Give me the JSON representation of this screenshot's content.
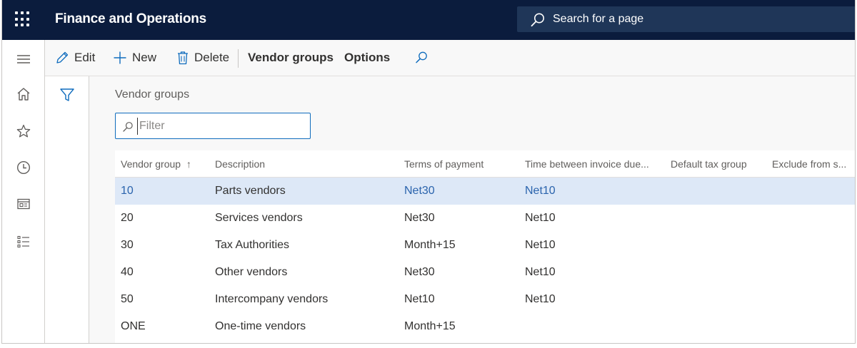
{
  "app": {
    "title": "Finance and Operations"
  },
  "search": {
    "placeholder": "Search for a page"
  },
  "nav": {
    "items": [
      {
        "name": "hamburger-icon"
      },
      {
        "name": "home-icon"
      },
      {
        "name": "star-icon"
      },
      {
        "name": "clock-icon"
      },
      {
        "name": "workspace-icon"
      },
      {
        "name": "list-icon"
      }
    ]
  },
  "actions": {
    "edit": "Edit",
    "new": "New",
    "delete": "Delete",
    "vendor_groups": "Vendor groups",
    "options": "Options"
  },
  "page": {
    "section_title": "Vendor groups",
    "filter_placeholder": "Filter"
  },
  "grid": {
    "columns": [
      "Vendor group",
      "Description",
      "Terms of payment",
      "Time between invoice due...",
      "Default tax group",
      "Exclude from s..."
    ],
    "sort_indicator": "↑",
    "rows": [
      {
        "group": "10",
        "description": "Parts vendors",
        "terms": "Net30",
        "time_between": "Net10",
        "tax_group": "",
        "exclude": "",
        "selected": true
      },
      {
        "group": "20",
        "description": "Services vendors",
        "terms": "Net30",
        "time_between": "Net10",
        "tax_group": "",
        "exclude": ""
      },
      {
        "group": "30",
        "description": "Tax Authorities",
        "terms": "Month+15",
        "time_between": "Net10",
        "tax_group": "",
        "exclude": ""
      },
      {
        "group": "40",
        "description": "Other vendors",
        "terms": "Net30",
        "time_between": "Net10",
        "tax_group": "",
        "exclude": ""
      },
      {
        "group": "50",
        "description": "Intercompany vendors",
        "terms": "Net10",
        "time_between": "Net10",
        "tax_group": "",
        "exclude": ""
      },
      {
        "group": "ONE",
        "description": "One-time vendors",
        "terms": "Month+15",
        "time_between": "",
        "tax_group": "",
        "exclude": ""
      }
    ]
  },
  "colors": {
    "topbar": "#0b1c3d",
    "accent": "#0f6cbd",
    "selected_row": "#dde8f7",
    "link": "#2b64ad"
  }
}
